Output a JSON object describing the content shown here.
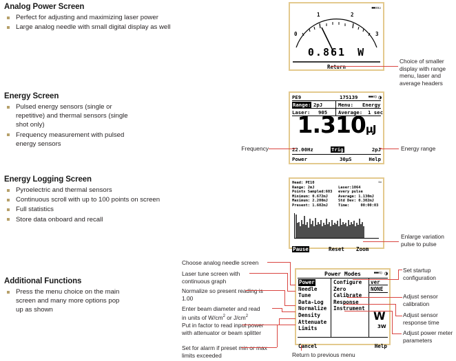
{
  "sections": [
    {
      "title": "Analog Power Screen",
      "bullets": [
        "Perfect for adjusting and maximizing laser power",
        "Large analog needle with small digital display as well"
      ]
    },
    {
      "title": "Energy Screen",
      "bullets": [
        "Pulsed energy sensors (single or repetitive) and thermal sensors (single shot only)",
        "Frequency measurement with pulsed energy sensors"
      ]
    },
    {
      "title": "Energy Logging Screen",
      "bullets": [
        "Pyroelectric and thermal sensors",
        "Continuous scroll with up to 100 points on screen",
        "Full statistics",
        "Store data onboard and recall"
      ]
    },
    {
      "title": "Additional Functions",
      "bullets": [
        "Press the menu choice on the main screen and many more options pop up as shown"
      ]
    }
  ],
  "analog_screen": {
    "scale_labels": [
      "0",
      "1",
      "2",
      "3"
    ],
    "digital_value": "0.861",
    "digital_unit": "W",
    "softkey": "Return",
    "battery_icon": "battery-icon"
  },
  "energy_screen": {
    "head": "PE9",
    "serial": "175139",
    "range_label": "Range:",
    "range_value": "2pJ",
    "menu_label": "Menu:",
    "menu_value": "Energy",
    "laser_label": "Laser:",
    "laser_value": "905",
    "average_label": "Average:",
    "average_value": "1 sec",
    "reading": "1.310",
    "reading_unit": "µJ",
    "frequency": "22.00Hz",
    "trig": "Trig",
    "range_right": "2pJ",
    "softkey_left": "Power",
    "softkey_mid": "30µS",
    "softkey_right": "Help"
  },
  "logging_screen": {
    "left_lines": [
      "Head: PE10",
      "Range: 2mJ",
      "Points Sampled:603",
      "Minimum: 0.672mJ",
      "Maximum: 2.200mJ",
      "Present: 1.602mJ"
    ],
    "right_lines": [
      "Laser:1064",
      "every pulse",
      "Average: 1.130mJ",
      "Std Dev: 0.302mJ",
      "Time:     00:00:03"
    ],
    "softkey_left": "Pause",
    "softkey_mid": "Reset",
    "softkey_right": "Zoom",
    "bar_values": [
      44,
      28,
      30,
      22,
      34,
      26,
      42,
      24,
      30,
      20,
      36,
      26,
      32,
      22,
      38,
      24,
      30,
      26,
      34,
      22,
      28,
      24,
      36,
      26,
      30,
      22,
      34,
      24,
      28,
      26,
      32,
      22,
      36,
      24,
      30,
      26,
      28,
      22,
      34,
      24,
      30,
      26,
      32,
      22,
      28,
      24,
      36,
      26,
      30,
      22
    ]
  },
  "menu_screen": {
    "title": "Power Modes",
    "col1": [
      "Power",
      "Needle",
      "Tune",
      "Data-Log",
      "Normalize",
      "Density",
      "Attenuate",
      "Limits"
    ],
    "col1_selected": "Power",
    "col2": [
      "Configure",
      "Zero",
      "Calibrate",
      "Response",
      "Instrument"
    ],
    "col3_top": "ver",
    "col3_value": "NONE",
    "col3_unit": "W",
    "col3_sub": "3W",
    "softkey_left": "Cancel",
    "softkey_right": "Help",
    "battery_icon": "battery-icon"
  },
  "callouts": {
    "smaller_display": "Choice of smaller display with range menu, laser and average headers",
    "frequency": "Frequency",
    "energy_range": "Energy range",
    "enlarge": "Enlarge variation pulse to pulse",
    "choose_needle": "Choose analog needle screen",
    "laser_tune": "Laser tune screen with continuous graph",
    "normalize": "Normalize so present reading is 1.00",
    "beam_diameter_a": "Enter beam diameter and read",
    "beam_diameter_b": "in units of W/cm",
    "beam_diameter_c": " or J/cm",
    "attenuator": "Put in factor to read input power with attenuator or beam splitter",
    "limits": "Set for alarm if preset min or max limits exceeded",
    "startup": "Set startup configuration",
    "calibration": "Adjust sensor calibration",
    "response": "Adjust sensor response time",
    "parameters": "Adjust power meter parameters",
    "return_menu": "Return to previous menu"
  }
}
